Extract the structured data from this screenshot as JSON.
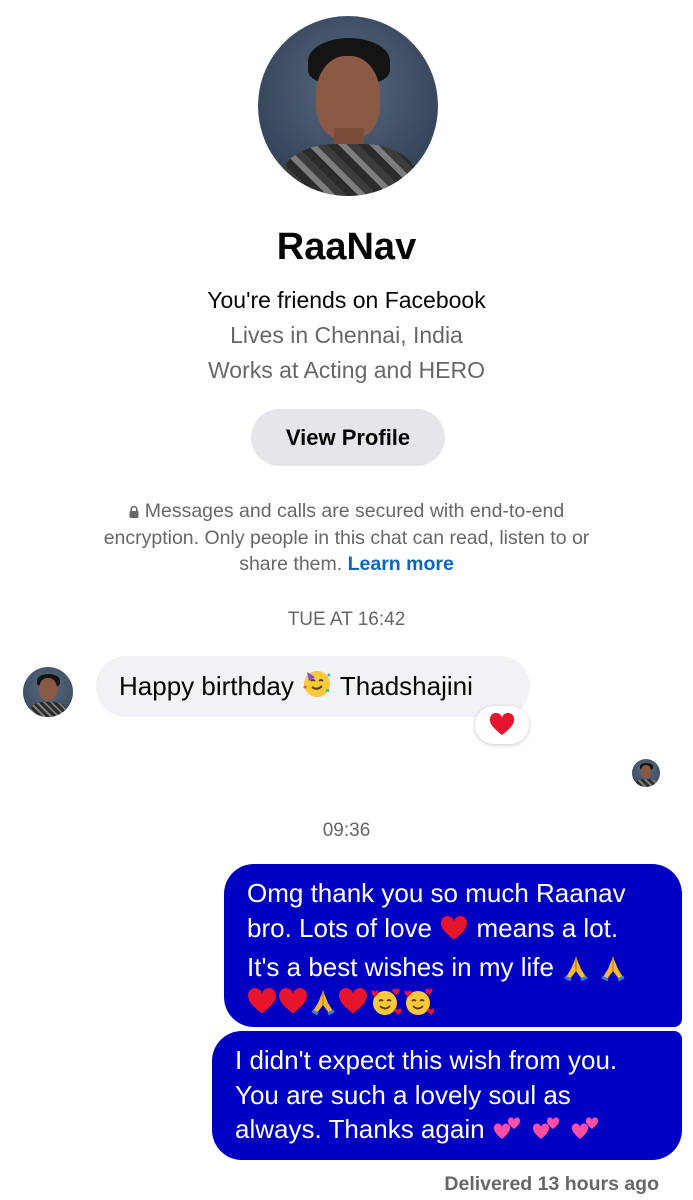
{
  "profile": {
    "name": "RaaNav",
    "friends_text": "You're friends on Facebook",
    "lives_text": "Lives in Chennai, India",
    "works_text": "Works at Acting and HERO",
    "view_profile_label": "View Profile"
  },
  "encryption": {
    "icon": "lock-icon",
    "text": "Messages and calls are secured with end-to-end encryption. Only people in this chat can read, listen to or share them.",
    "learn_more_label": "Learn more",
    "link_color": "#0a66c2"
  },
  "conversation": {
    "timestamp_1": "TUE AT 16:42",
    "incoming_message": {
      "text_before": "Happy birthday",
      "emoji": "partying-face-emoji",
      "text_after": "Thadshajini",
      "reaction": "red-heart-emoji"
    },
    "timestamp_2": "09:36",
    "outgoing_messages": [
      {
        "line_1": "Omg thank you so much Raanav",
        "line_2a": "bro. Lots of love",
        "line_2b": "means a lot.",
        "line_3": "It's a best wishes in my life",
        "emoji_row": [
          "red-heart-emoji",
          "red-heart-emoji",
          "folded-hands-emoji",
          "red-heart-emoji",
          "smiling-face-with-hearts-emoji",
          "smiling-face-with-hearts-emoji"
        ]
      },
      {
        "line_1": "I didn't expect this wish from you.",
        "line_2": "You are such a lovely soul as",
        "line_3": "always. Thanks again"
      }
    ],
    "delivered_status": "Delivered 13 hours ago",
    "bubble_color": "#0000c3"
  }
}
